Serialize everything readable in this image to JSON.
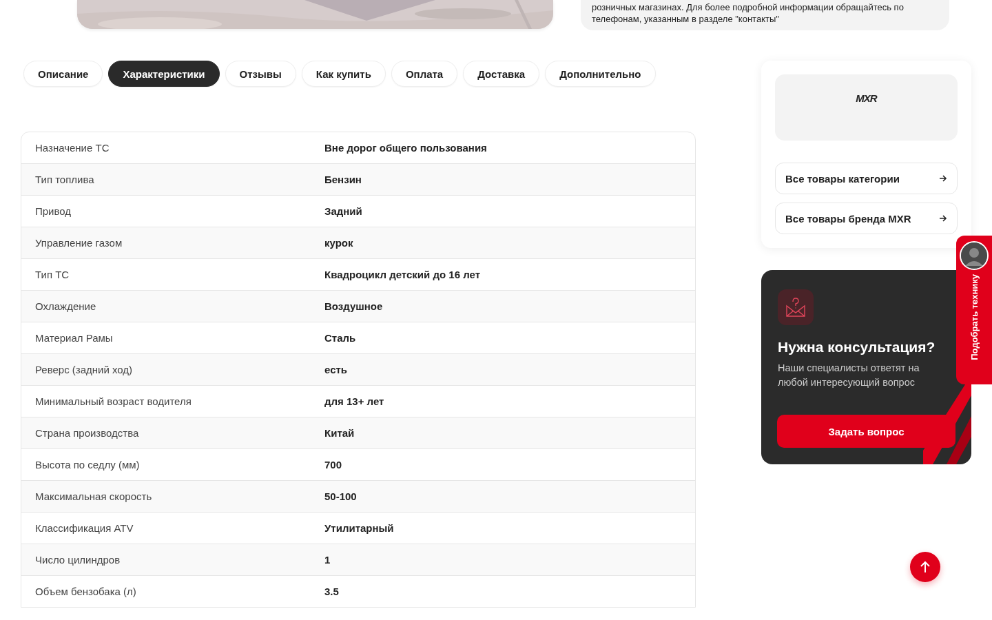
{
  "top_info": {
    "lines": [
      "розничных магазинах. Для более подробной информации обращайтесь по",
      "телефонам, указанным в разделе \"контакты\""
    ]
  },
  "tabs": [
    {
      "label": "Описание",
      "selected": false
    },
    {
      "label": "Характеристики",
      "selected": true
    },
    {
      "label": "Отзывы",
      "selected": false
    },
    {
      "label": "Как купить",
      "selected": false
    },
    {
      "label": "Оплата",
      "selected": false
    },
    {
      "label": "Доставка",
      "selected": false
    },
    {
      "label": "Дополнительно",
      "selected": false
    }
  ],
  "specs": [
    {
      "name": "Назначение ТС",
      "value": "Вне дорог общего пользования"
    },
    {
      "name": "Тип топлива",
      "value": "Бензин"
    },
    {
      "name": "Привод",
      "value": "Задний"
    },
    {
      "name": "Управление газом",
      "value": "курок"
    },
    {
      "name": "Тип ТС",
      "value": "Квадроцикл детский до 16 лет"
    },
    {
      "name": "Охлаждение",
      "value": "Воздушное"
    },
    {
      "name": "Материал Рамы",
      "value": "Сталь"
    },
    {
      "name": "Реверс (задний ход)",
      "value": "есть"
    },
    {
      "name": "Минимальный возраст водителя",
      "value": "для 13+ лет"
    },
    {
      "name": "Страна производства",
      "value": "Китай"
    },
    {
      "name": "Высота по седлу (мм)",
      "value": "700"
    },
    {
      "name": "Максимальная скорость",
      "value": "50-100"
    },
    {
      "name": "Классификация ATV",
      "value": "Утилитарный"
    },
    {
      "name": "Число цилиндров",
      "value": "1"
    },
    {
      "name": "Объем бензобака (л)",
      "value": "3.5"
    }
  ],
  "brand": {
    "logo": "MXR",
    "links": [
      "Все товары категории",
      "Все товары бренда MXR"
    ]
  },
  "consult": {
    "title": "Нужна консультация?",
    "text": "Наши специалисты ответят на любой интересующий вопрос",
    "button": "Задать вопрос"
  },
  "side_tab": {
    "label": "Подобрать технику"
  }
}
